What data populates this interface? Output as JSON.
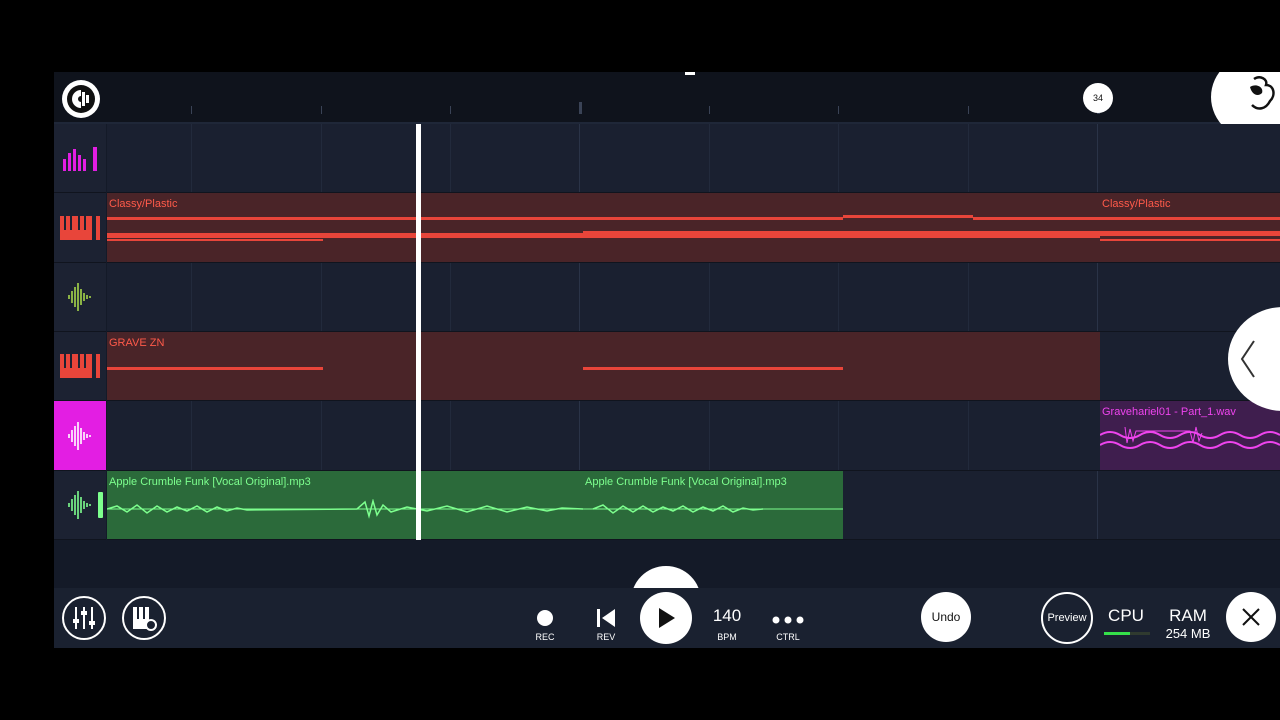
{
  "ruler": {
    "bar_marker": "34"
  },
  "tracks": [
    {
      "name": "drum-track",
      "icon": "drum-bars-icon",
      "icon_color": "#e31ee3"
    },
    {
      "name": "piano-track-1",
      "icon": "keyboard-icon",
      "icon_color": "#e8453a",
      "clip_label": "Classy/Plastic",
      "clip_label_2": "Classy/Plastic"
    },
    {
      "name": "audio-track-1",
      "icon": "waveform-icon",
      "icon_color": "#a6d64a"
    },
    {
      "name": "piano-track-2",
      "icon": "keyboard-icon",
      "icon_color": "#e8453a",
      "clip_label": "GRAVE ZN"
    },
    {
      "name": "audio-track-2",
      "icon": "waveform-icon",
      "icon_color": "#ffffff",
      "clip_label": "Gravehariel01 - Part_1.wav"
    },
    {
      "name": "audio-track-3",
      "icon": "waveform-icon",
      "icon_color": "#7dff8e",
      "clip_label": "Apple Crumble Funk [Vocal Original].mp3",
      "clip_label_2": "Apple Crumble Funk [Vocal Original].mp3"
    }
  ],
  "toolbar": {
    "rec_label": "REC",
    "rev_label": "REV",
    "bpm_value": "140",
    "bpm_label": "BPM",
    "ctrl_label": "CTRL",
    "undo_label": "Undo",
    "preview_label": "Preview",
    "cpu_label": "CPU",
    "ram_label": "RAM",
    "ram_value": "254 MB"
  },
  "colors": {
    "accent_magenta": "#e31ee3",
    "accent_red": "#e8453a",
    "accent_green": "#7dff8e"
  }
}
